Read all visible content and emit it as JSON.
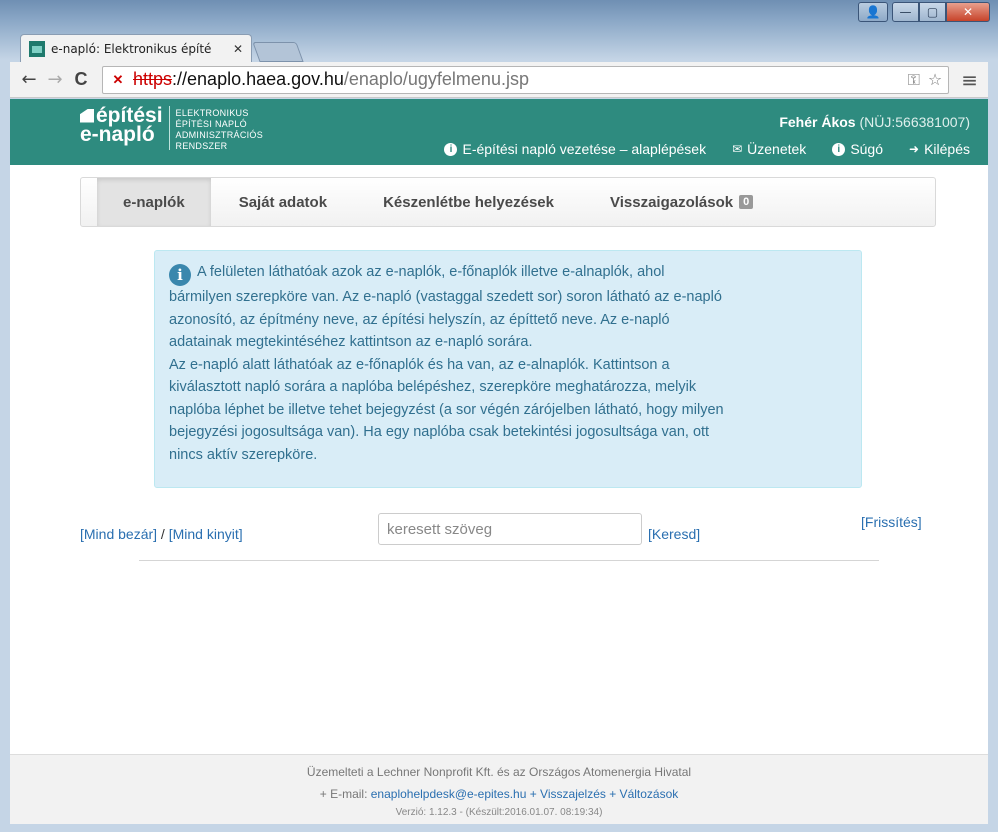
{
  "window": {
    "controls": {
      "user": "👤",
      "minimize": "—",
      "maximize": "▢",
      "close": "✕"
    }
  },
  "tabs": [
    {
      "title": "e-napló: Elektronikus építé",
      "close": "✕"
    }
  ],
  "toolbar": {
    "back": "←",
    "forward": "→",
    "reload": "C",
    "url_scheme": "https",
    "url_host": "://enaplo.haea.gov.hu",
    "url_path": "/enaplo/ugyfelmenu.jsp",
    "key_icon": "⚿",
    "star_icon": "☆",
    "menu_icon": "≡"
  },
  "header": {
    "logo_line1": "építési",
    "logo_line2": "e-napló",
    "logo_sub": [
      "ELEKTRONIKUS",
      "ÉPÍTÉSI NAPLÓ",
      "ADMINISZTRÁCIÓS",
      "RENDSZER"
    ],
    "user_name": "Fehér Ákos",
    "user_id": " (NÜJ:566381007)",
    "nav": {
      "guide": "E-építési napló vezetése – alaplépések",
      "messages": "Üzenetek",
      "help": "Súgó",
      "logout": "Kilépés"
    }
  },
  "subnav": {
    "items": [
      "e-naplók",
      "Saját adatok",
      "Készenlétbe helyezések",
      "Visszaigazolások"
    ],
    "badge": "0"
  },
  "info": {
    "lines": [
      "A felületen láthatóak azok az e-naplók, e-főnaplók illetve e-alnaplók, ahol",
      "bármilyen szerepköre van. Az e-napló (vastaggal szedett sor) soron látható az e-napló",
      "azonosító, az építmény neve, az építési helyszín, az építtető neve. Az e-napló",
      "adatainak megtekintéséhez kattintson az e-napló sorára.",
      "Az e-napló alatt láthatóak az e-főnaplók és ha van, az e-alnaplók. Kattintson a",
      "kiválasztott napló sorára a naplóba belépéshez, szerepköre meghatározza, melyik",
      "naplóba léphet be illetve tehet bejegyzést (a sor végén zárójelben látható, hogy milyen",
      "bejegyzési jogosultsága van). Ha egy naplóba csak betekintési jogosultsága van, ott",
      "nincs aktív szerepköre."
    ]
  },
  "search": {
    "close_all": "[Mind bezár]",
    "separator": " / ",
    "open_all": "[Mind kinyit]",
    "placeholder": "keresett szöveg",
    "submit": "[Keresd]",
    "refresh": "[Frissítés]"
  },
  "footer": {
    "line1": "Üzemelteti a Lechner Nonprofit Kft. és az Országos Atomenergia Hivatal",
    "email_prefix": "+ E-mail: ",
    "email": "enaplohelpdesk@e-epites.hu",
    "feedback": "+ Visszajelzés",
    "changes": "+ Változások",
    "version": "Verzió: 1.12.3 - (Készült:2016.01.07. 08:19:34)"
  }
}
